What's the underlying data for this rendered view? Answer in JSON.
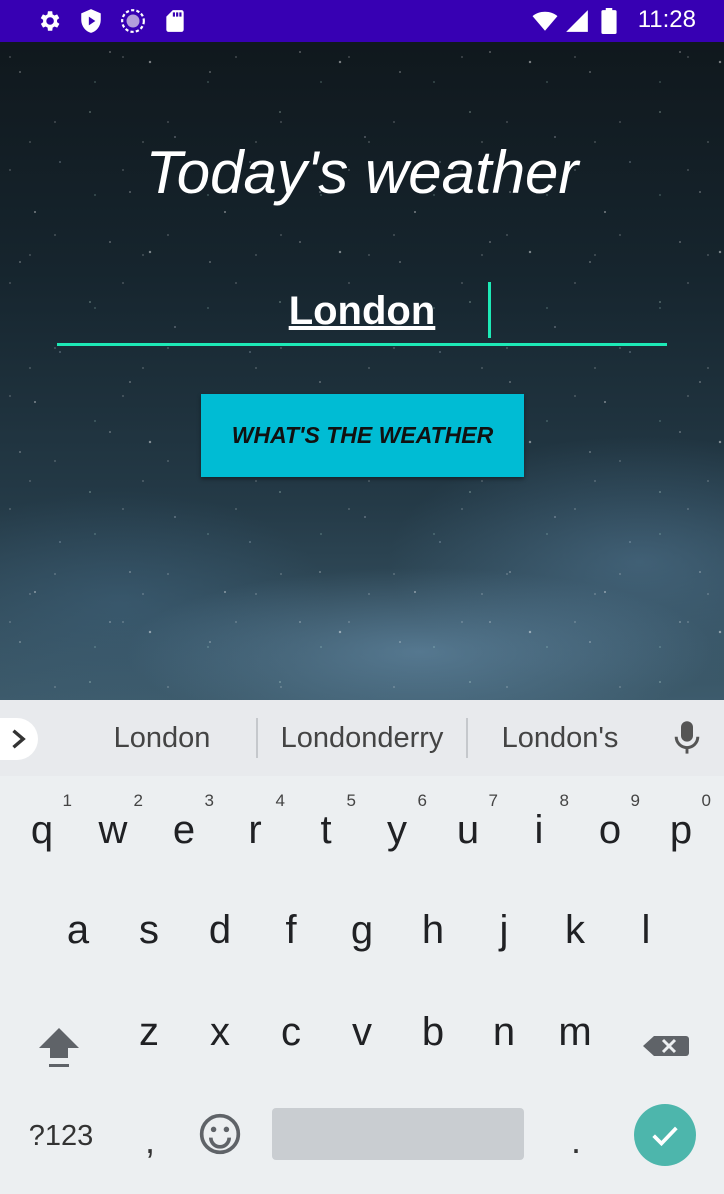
{
  "status_bar": {
    "time": "11:28",
    "left_icons": [
      "settings-icon",
      "play-protect-icon",
      "sync-circle-icon",
      "sd-card-icon"
    ],
    "right_icons": [
      "wifi-icon",
      "signal-icon",
      "battery-icon"
    ],
    "background": "#3700b3"
  },
  "app": {
    "title": "Today's weather",
    "city_input": {
      "value": "London",
      "underline_color": "#1de9b6"
    },
    "weather_button": {
      "label": "WHAT'S THE WEATHER",
      "color": "#00bcd4"
    }
  },
  "keyboard": {
    "suggestions": [
      "London",
      "Londonderry",
      "London's"
    ],
    "row1": [
      {
        "key": "q",
        "hint": "1"
      },
      {
        "key": "w",
        "hint": "2"
      },
      {
        "key": "e",
        "hint": "3"
      },
      {
        "key": "r",
        "hint": "4"
      },
      {
        "key": "t",
        "hint": "5"
      },
      {
        "key": "y",
        "hint": "6"
      },
      {
        "key": "u",
        "hint": "7"
      },
      {
        "key": "i",
        "hint": "8"
      },
      {
        "key": "o",
        "hint": "9"
      },
      {
        "key": "p",
        "hint": "0"
      }
    ],
    "row2": [
      "a",
      "s",
      "d",
      "f",
      "g",
      "h",
      "j",
      "k",
      "l"
    ],
    "row3": [
      "z",
      "x",
      "c",
      "v",
      "b",
      "n",
      "m"
    ],
    "symbols_label": "?123",
    "comma": ",",
    "period": ".",
    "enter_color": "#4db6ac"
  }
}
